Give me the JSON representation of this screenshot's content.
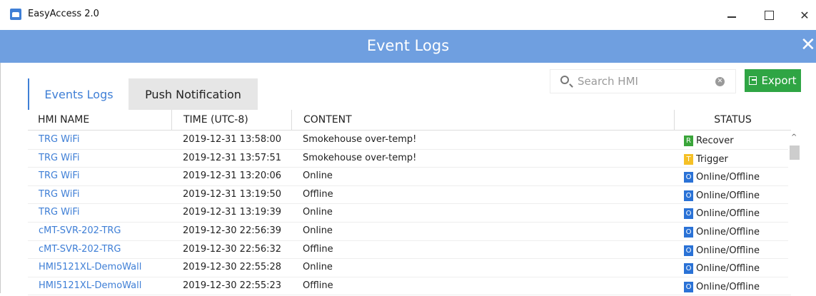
{
  "window": {
    "title": "EasyAccess 2.0",
    "controls": {
      "minimize": "minimize",
      "maximize": "maximize",
      "close": "✕"
    }
  },
  "header": {
    "title": "Event Logs",
    "close_glyph": "✕",
    "color": "#6f9fe0"
  },
  "tabs": [
    {
      "label": "Events Logs",
      "active": true
    },
    {
      "label": "Push Notification",
      "active": false
    }
  ],
  "search": {
    "placeholder": "Search HMI",
    "value": ""
  },
  "export": {
    "label": "Export",
    "color": "#2fa544"
  },
  "table": {
    "columns": [
      "HMI NAME",
      "TIME (UTC-8)",
      "CONTENT",
      "STATUS"
    ],
    "rows": [
      {
        "hmi": "TRG WiFi",
        "time": "2019-12-31 13:58:00",
        "content": "Smokehouse over-temp!",
        "status_badge": "R",
        "status": "Recover",
        "badge_color": "#3aa53a"
      },
      {
        "hmi": "TRG WiFi",
        "time": "2019-12-31 13:57:51",
        "content": "Smokehouse over-temp!",
        "status_badge": "T",
        "status": "Trigger",
        "badge_color": "#f5c026"
      },
      {
        "hmi": "TRG WiFi",
        "time": "2019-12-31 13:20:06",
        "content": "Online",
        "status_badge": "O",
        "status": "Online/Offline",
        "badge_color": "#2a72d6"
      },
      {
        "hmi": "TRG WiFi",
        "time": "2019-12-31 13:19:50",
        "content": "Offline",
        "status_badge": "O",
        "status": "Online/Offline",
        "badge_color": "#2a72d6"
      },
      {
        "hmi": "TRG WiFi",
        "time": "2019-12-31 13:19:39",
        "content": "Online",
        "status_badge": "O",
        "status": "Online/Offline",
        "badge_color": "#2a72d6"
      },
      {
        "hmi": "cMT-SVR-202-TRG",
        "time": "2019-12-30 22:56:39",
        "content": "Online",
        "status_badge": "O",
        "status": "Online/Offline",
        "badge_color": "#2a72d6"
      },
      {
        "hmi": "cMT-SVR-202-TRG",
        "time": "2019-12-30 22:56:32",
        "content": "Offline",
        "status_badge": "O",
        "status": "Online/Offline",
        "badge_color": "#2a72d6"
      },
      {
        "hmi": "HMI5121XL-DemoWall",
        "time": "2019-12-30 22:55:28",
        "content": "Online",
        "status_badge": "O",
        "status": "Online/Offline",
        "badge_color": "#2a72d6"
      },
      {
        "hmi": "HMI5121XL-DemoWall",
        "time": "2019-12-30 22:55:23",
        "content": "Offline",
        "status_badge": "O",
        "status": "Online/Offline",
        "badge_color": "#2a72d6"
      }
    ]
  }
}
